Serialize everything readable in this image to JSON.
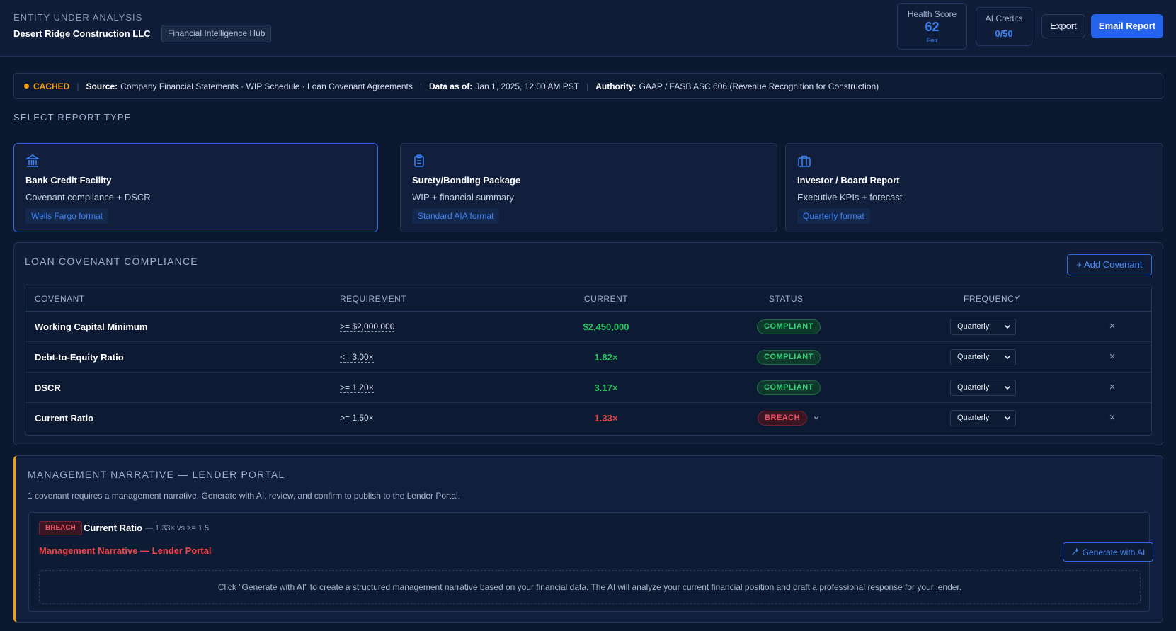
{
  "header": {
    "entity_caption": "ENTITY UNDER ANALYSIS",
    "entity_name": "Desert Ridge Construction LLC",
    "hub_badge": "Financial Intelligence Hub",
    "health_score": {
      "label": "Health Score",
      "value": "62",
      "rating": "Fair"
    },
    "ai_credits": {
      "label": "AI Credits",
      "value": "0/50"
    },
    "export_label": "Export",
    "email_label": "Email Report"
  },
  "source_bar": {
    "cached_label": "CACHED",
    "source_key": "Source:",
    "source_value": "Company Financial Statements · WIP Schedule · Loan Covenant Agreements",
    "data_as_of_key": "Data as of:",
    "data_as_of_value": "Jan 1, 2025, 12:00 AM PST",
    "authority_key": "Authority:",
    "authority_value": "GAAP / FASB ASC 606 (Revenue Recognition for Construction)"
  },
  "report_types": {
    "heading": "SELECT REPORT TYPE",
    "cards": [
      {
        "icon": "bank-icon",
        "title": "Bank Credit Facility",
        "description": "Covenant compliance + DSCR",
        "format": "Wells Fargo format",
        "selected": true
      },
      {
        "icon": "clipboard-icon",
        "title": "Surety/Bonding Package",
        "description": "WIP + financial summary",
        "format": "Standard AIA format",
        "selected": false
      },
      {
        "icon": "briefcase-icon",
        "title": "Investor / Board Report",
        "description": "Executive KPIs + forecast",
        "format": "Quarterly format",
        "selected": false
      }
    ]
  },
  "covenants": {
    "title": "LOAN COVENANT COMPLIANCE",
    "add_label": "+ Add Covenant",
    "columns": [
      "COVENANT",
      "REQUIREMENT",
      "CURRENT",
      "STATUS",
      "FREQUENCY"
    ],
    "rows": [
      {
        "name": "Working Capital Minimum",
        "requirement": ">= $2,000,000",
        "current": "$2,450,000",
        "status": "COMPLIANT",
        "frequency": "Quarterly"
      },
      {
        "name": "Debt-to-Equity Ratio",
        "requirement": "<= 3.00×",
        "current": "1.82×",
        "status": "COMPLIANT",
        "frequency": "Quarterly"
      },
      {
        "name": "DSCR",
        "requirement": ">= 1.20×",
        "current": "3.17×",
        "status": "COMPLIANT",
        "frequency": "Quarterly"
      },
      {
        "name": "Current Ratio",
        "requirement": ">= 1.50×",
        "current": "1.33×",
        "status": "BREACH",
        "frequency": "Quarterly"
      }
    ],
    "remove_glyph": "×"
  },
  "narrative": {
    "title": "MANAGEMENT NARRATIVE — LENDER PORTAL",
    "subtitle": "1 covenant requires a management narrative. Generate with AI, review, and confirm to publish to the Lender Portal.",
    "item": {
      "badge": "BREACH",
      "metric": "Current Ratio",
      "comparison": "— 1.33× vs >= 1.5",
      "portal_label": "Management Narrative — Lender Portal",
      "generate_label": "Generate with AI",
      "empty_text": "Click \"Generate with AI\" to create a structured management narrative based on your financial data. The AI will analyze your current financial position and draft a professional response for your lender."
    }
  },
  "colors": {
    "accent": "#2563eb",
    "compliant": "#22c55e",
    "breach": "#ef4444",
    "cached": "#f59e0b"
  }
}
